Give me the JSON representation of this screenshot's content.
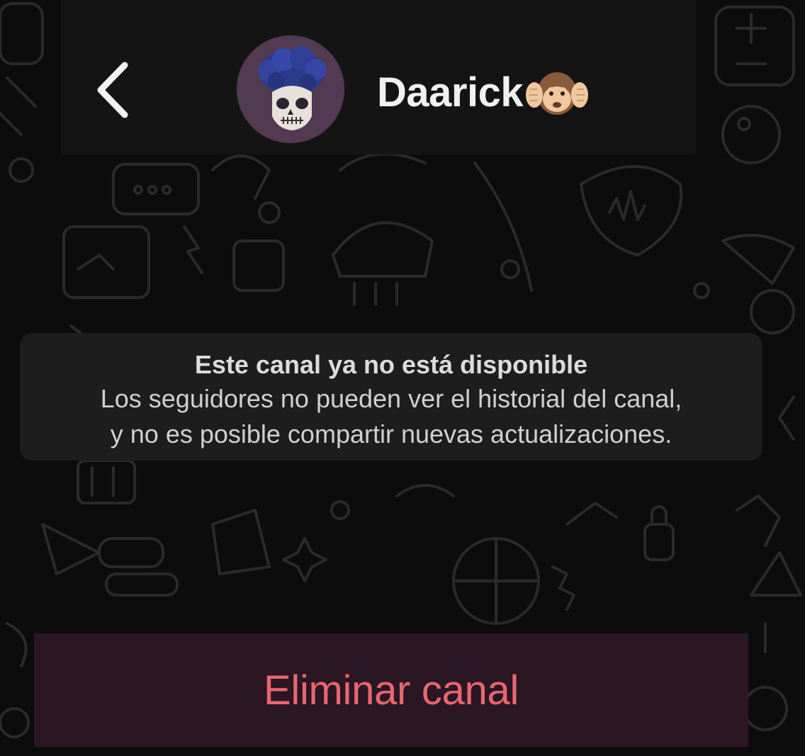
{
  "header": {
    "channel_name": "Daarick",
    "channel_emoji": "hear-no-evil-monkey-icon",
    "back_icon": "chevron-left-icon"
  },
  "notice": {
    "title": "Este canal ya no está disponible",
    "body": "Los seguidores no pueden ver el historial del canal,\ny no es posible compartir nuevas actualizaciones."
  },
  "actions": {
    "delete_label": "Eliminar canal"
  },
  "colors": {
    "background": "#0c0c0c",
    "header": "#141414",
    "notice": "#1d1d1d",
    "delete_bar": "#2a1723",
    "delete_text": "#e86670"
  }
}
